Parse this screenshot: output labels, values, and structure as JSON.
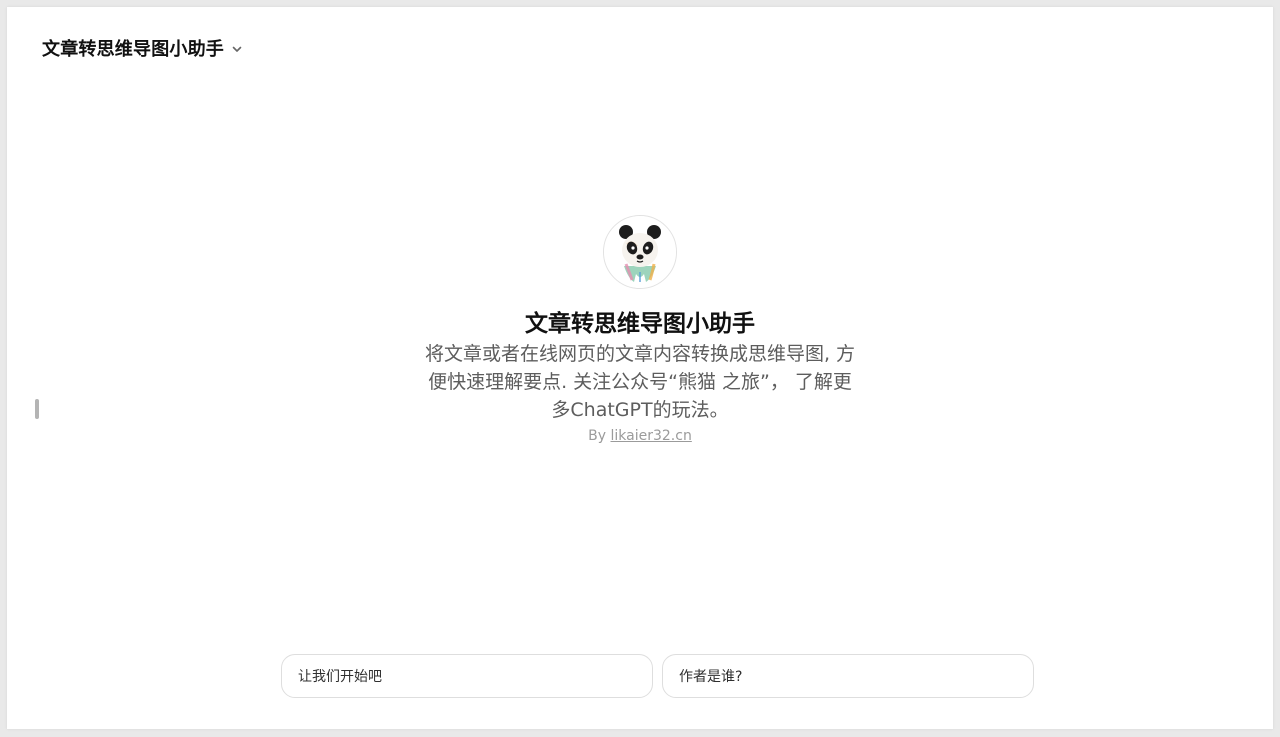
{
  "header": {
    "title": "文章转思维导图小助手",
    "chevron_icon": "chevron-down-icon"
  },
  "hero": {
    "avatar_icon": "panda-avatar-icon",
    "title": "文章转思维导图小助手",
    "description": "将文章或者在线网页的文章内容转换成思维导图, 方便快速理解要点. 关注公众号“熊猫        之旅”， 了解更多ChatGPT的玩法。",
    "by_label": "By",
    "author_link": "likaier32.cn"
  },
  "starters": [
    {
      "label": "让我们开始吧"
    },
    {
      "label": "作者是谁?"
    }
  ],
  "colors": {
    "background": "#ffffff",
    "frame": "#e9e9e9",
    "title_text": "#111111",
    "description_text": "#5d5d5d",
    "muted_text": "#9b9b9b",
    "border": "#dedede"
  }
}
